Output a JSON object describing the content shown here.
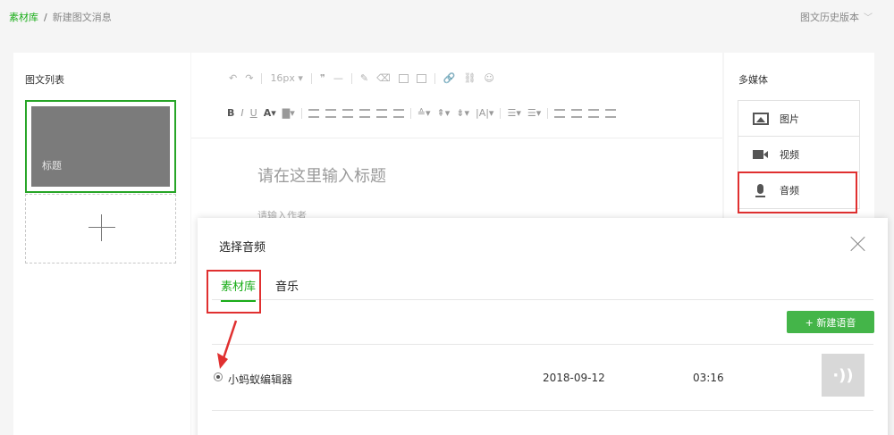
{
  "breadcrumb": {
    "root": "素材库",
    "sep": "/",
    "current": "新建图文消息"
  },
  "history_label": "图文历史版本",
  "left_panel": {
    "title": "图文列表",
    "article_title": "标题"
  },
  "toolbar": {
    "font_size": "16px"
  },
  "editor": {
    "title_placeholder": "请在这里输入标题",
    "author_placeholder": "请输入作者"
  },
  "media_panel": {
    "title": "多媒体",
    "items": [
      {
        "label": "图片",
        "icon": "image-icon"
      },
      {
        "label": "视频",
        "icon": "video-icon"
      },
      {
        "label": "音频",
        "icon": "microphone-icon"
      }
    ]
  },
  "modal": {
    "title": "选择音频",
    "tabs": [
      "素材库",
      "音乐"
    ],
    "new_button": "+ 新建语音",
    "audio": {
      "name": "小蚂蚁编辑器",
      "date": "2018-09-12",
      "duration": "03:16"
    }
  },
  "colors": {
    "accent": "#1aad19",
    "annotation": "#e03030"
  }
}
